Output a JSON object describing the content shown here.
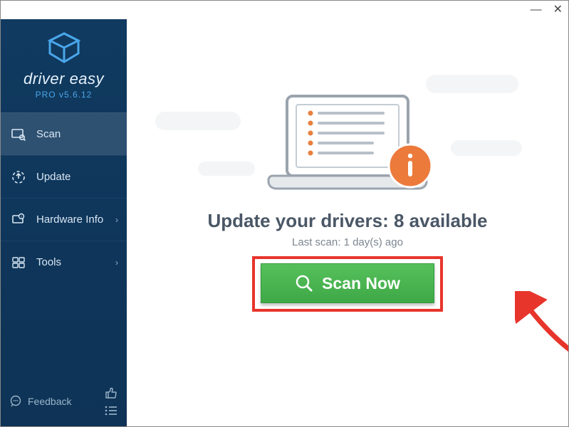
{
  "app": {
    "brand": "driver easy",
    "version": "PRO v5.6.12"
  },
  "sidebar": {
    "items": [
      {
        "label": "Scan"
      },
      {
        "label": "Update"
      },
      {
        "label": "Hardware Info"
      },
      {
        "label": "Tools"
      }
    ],
    "feedback_label": "Feedback"
  },
  "main": {
    "headline": "Update your drivers: 8 available",
    "subline": "Last scan: 1 day(s) ago",
    "scan_button": "Scan Now"
  }
}
